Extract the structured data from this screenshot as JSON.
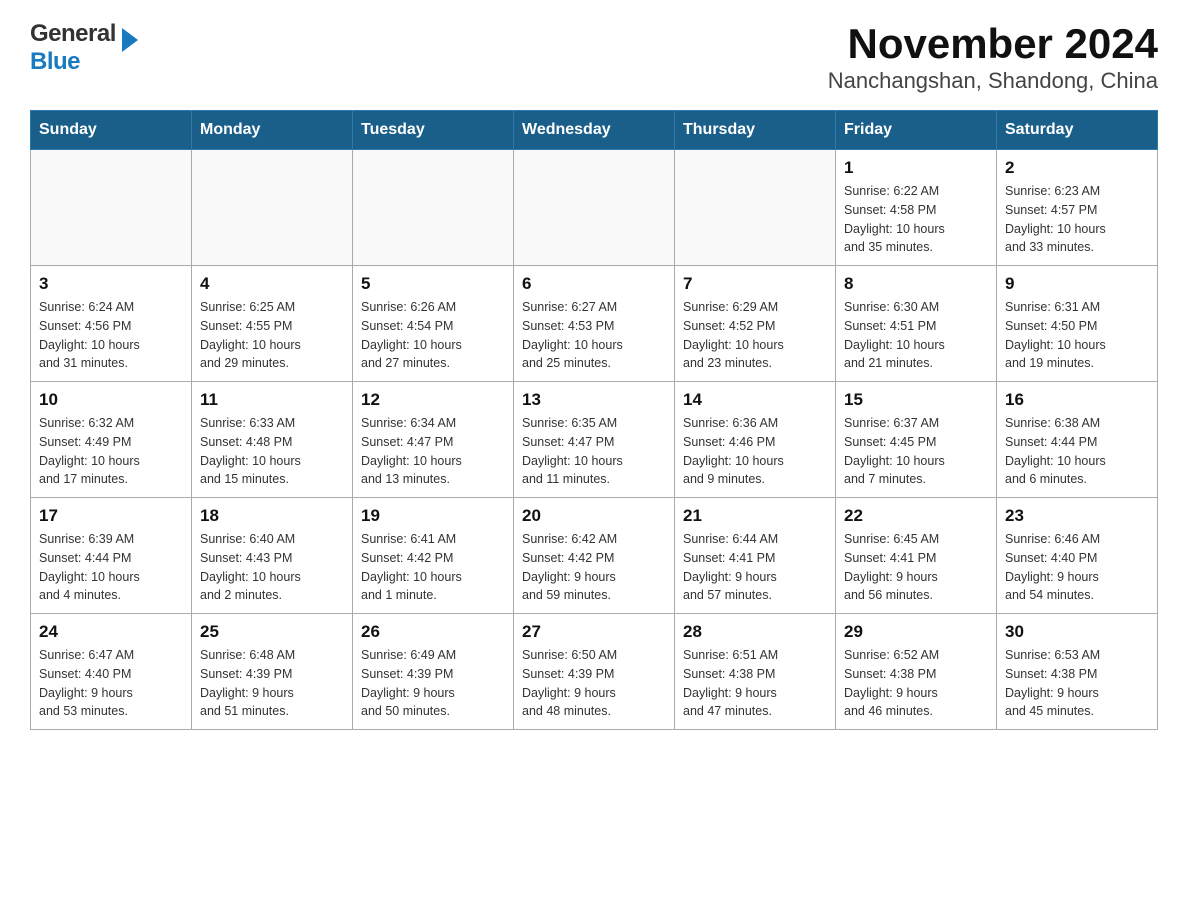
{
  "header": {
    "logo_line1": "General",
    "logo_line2": "Blue",
    "title": "November 2024",
    "subtitle": "Nanchangshan, Shandong, China"
  },
  "calendar": {
    "days_of_week": [
      "Sunday",
      "Monday",
      "Tuesday",
      "Wednesday",
      "Thursday",
      "Friday",
      "Saturday"
    ],
    "weeks": [
      [
        {
          "day": "",
          "info": ""
        },
        {
          "day": "",
          "info": ""
        },
        {
          "day": "",
          "info": ""
        },
        {
          "day": "",
          "info": ""
        },
        {
          "day": "",
          "info": ""
        },
        {
          "day": "1",
          "info": "Sunrise: 6:22 AM\nSunset: 4:58 PM\nDaylight: 10 hours\nand 35 minutes."
        },
        {
          "day": "2",
          "info": "Sunrise: 6:23 AM\nSunset: 4:57 PM\nDaylight: 10 hours\nand 33 minutes."
        }
      ],
      [
        {
          "day": "3",
          "info": "Sunrise: 6:24 AM\nSunset: 4:56 PM\nDaylight: 10 hours\nand 31 minutes."
        },
        {
          "day": "4",
          "info": "Sunrise: 6:25 AM\nSunset: 4:55 PM\nDaylight: 10 hours\nand 29 minutes."
        },
        {
          "day": "5",
          "info": "Sunrise: 6:26 AM\nSunset: 4:54 PM\nDaylight: 10 hours\nand 27 minutes."
        },
        {
          "day": "6",
          "info": "Sunrise: 6:27 AM\nSunset: 4:53 PM\nDaylight: 10 hours\nand 25 minutes."
        },
        {
          "day": "7",
          "info": "Sunrise: 6:29 AM\nSunset: 4:52 PM\nDaylight: 10 hours\nand 23 minutes."
        },
        {
          "day": "8",
          "info": "Sunrise: 6:30 AM\nSunset: 4:51 PM\nDaylight: 10 hours\nand 21 minutes."
        },
        {
          "day": "9",
          "info": "Sunrise: 6:31 AM\nSunset: 4:50 PM\nDaylight: 10 hours\nand 19 minutes."
        }
      ],
      [
        {
          "day": "10",
          "info": "Sunrise: 6:32 AM\nSunset: 4:49 PM\nDaylight: 10 hours\nand 17 minutes."
        },
        {
          "day": "11",
          "info": "Sunrise: 6:33 AM\nSunset: 4:48 PM\nDaylight: 10 hours\nand 15 minutes."
        },
        {
          "day": "12",
          "info": "Sunrise: 6:34 AM\nSunset: 4:47 PM\nDaylight: 10 hours\nand 13 minutes."
        },
        {
          "day": "13",
          "info": "Sunrise: 6:35 AM\nSunset: 4:47 PM\nDaylight: 10 hours\nand 11 minutes."
        },
        {
          "day": "14",
          "info": "Sunrise: 6:36 AM\nSunset: 4:46 PM\nDaylight: 10 hours\nand 9 minutes."
        },
        {
          "day": "15",
          "info": "Sunrise: 6:37 AM\nSunset: 4:45 PM\nDaylight: 10 hours\nand 7 minutes."
        },
        {
          "day": "16",
          "info": "Sunrise: 6:38 AM\nSunset: 4:44 PM\nDaylight: 10 hours\nand 6 minutes."
        }
      ],
      [
        {
          "day": "17",
          "info": "Sunrise: 6:39 AM\nSunset: 4:44 PM\nDaylight: 10 hours\nand 4 minutes."
        },
        {
          "day": "18",
          "info": "Sunrise: 6:40 AM\nSunset: 4:43 PM\nDaylight: 10 hours\nand 2 minutes."
        },
        {
          "day": "19",
          "info": "Sunrise: 6:41 AM\nSunset: 4:42 PM\nDaylight: 10 hours\nand 1 minute."
        },
        {
          "day": "20",
          "info": "Sunrise: 6:42 AM\nSunset: 4:42 PM\nDaylight: 9 hours\nand 59 minutes."
        },
        {
          "day": "21",
          "info": "Sunrise: 6:44 AM\nSunset: 4:41 PM\nDaylight: 9 hours\nand 57 minutes."
        },
        {
          "day": "22",
          "info": "Sunrise: 6:45 AM\nSunset: 4:41 PM\nDaylight: 9 hours\nand 56 minutes."
        },
        {
          "day": "23",
          "info": "Sunrise: 6:46 AM\nSunset: 4:40 PM\nDaylight: 9 hours\nand 54 minutes."
        }
      ],
      [
        {
          "day": "24",
          "info": "Sunrise: 6:47 AM\nSunset: 4:40 PM\nDaylight: 9 hours\nand 53 minutes."
        },
        {
          "day": "25",
          "info": "Sunrise: 6:48 AM\nSunset: 4:39 PM\nDaylight: 9 hours\nand 51 minutes."
        },
        {
          "day": "26",
          "info": "Sunrise: 6:49 AM\nSunset: 4:39 PM\nDaylight: 9 hours\nand 50 minutes."
        },
        {
          "day": "27",
          "info": "Sunrise: 6:50 AM\nSunset: 4:39 PM\nDaylight: 9 hours\nand 48 minutes."
        },
        {
          "day": "28",
          "info": "Sunrise: 6:51 AM\nSunset: 4:38 PM\nDaylight: 9 hours\nand 47 minutes."
        },
        {
          "day": "29",
          "info": "Sunrise: 6:52 AM\nSunset: 4:38 PM\nDaylight: 9 hours\nand 46 minutes."
        },
        {
          "day": "30",
          "info": "Sunrise: 6:53 AM\nSunset: 4:38 PM\nDaylight: 9 hours\nand 45 minutes."
        }
      ]
    ]
  }
}
